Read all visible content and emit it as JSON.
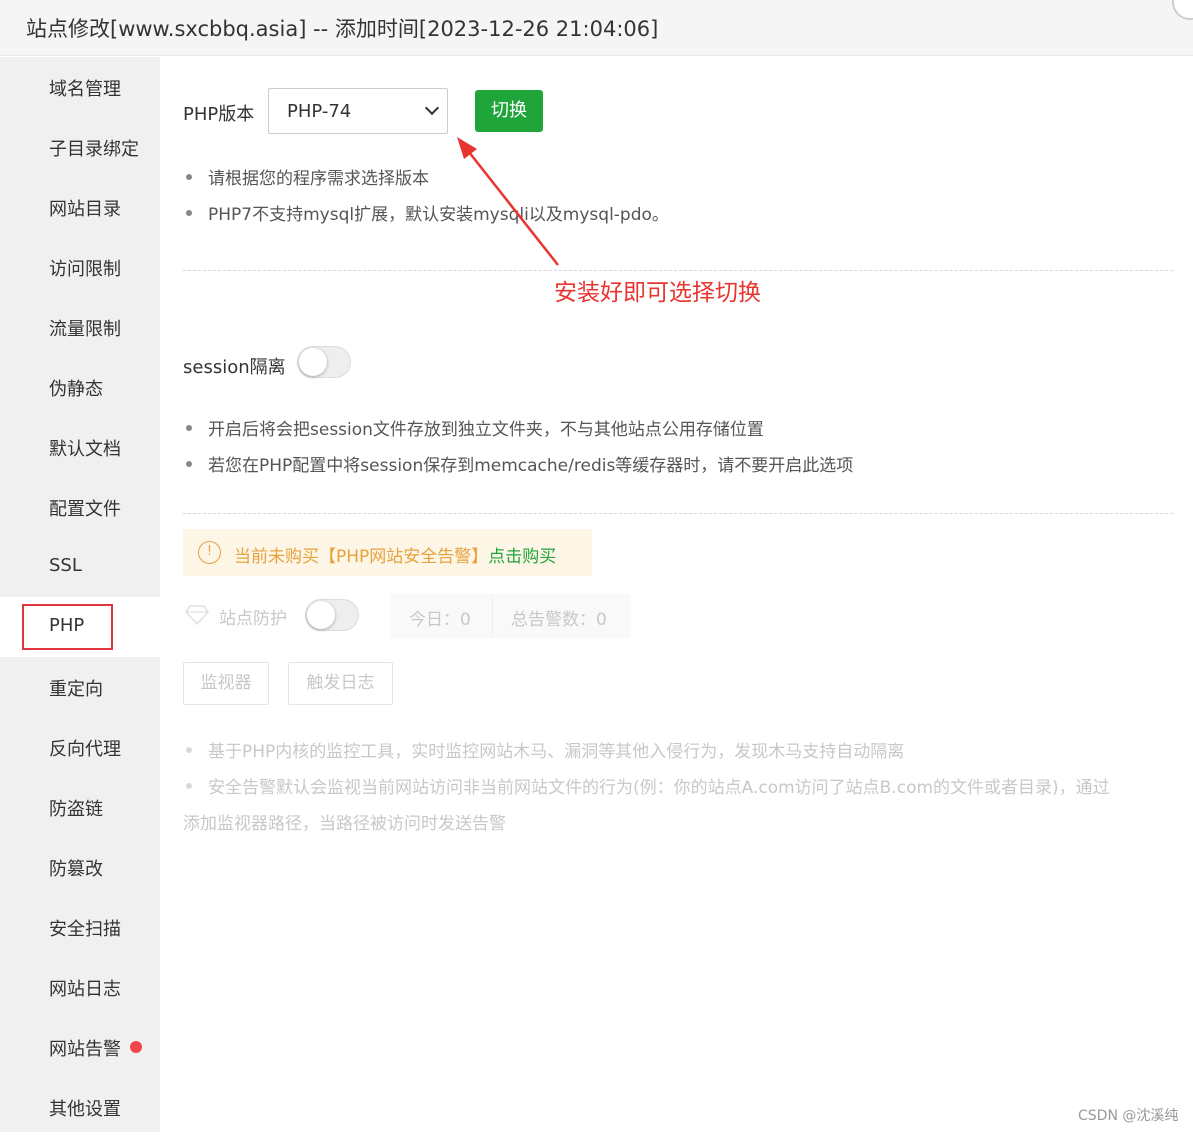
{
  "window": {
    "title": "站点修改[www.sxcbbq.asia] -- 添加时间[2023-12-26 21:04:06]"
  },
  "sidebar": {
    "items": [
      {
        "label": "域名管理"
      },
      {
        "label": "子目录绑定"
      },
      {
        "label": "网站目录"
      },
      {
        "label": "访问限制"
      },
      {
        "label": "流量限制"
      },
      {
        "label": "伪静态"
      },
      {
        "label": "默认文档"
      },
      {
        "label": "配置文件"
      },
      {
        "label": "SSL"
      },
      {
        "label": "PHP",
        "active": true
      },
      {
        "label": "重定向"
      },
      {
        "label": "反向代理"
      },
      {
        "label": "防盗链"
      },
      {
        "label": "防篡改"
      },
      {
        "label": "安全扫描"
      },
      {
        "label": "网站日志"
      },
      {
        "label": "网站告警",
        "badge": "red-dot"
      },
      {
        "label": "其他设置"
      }
    ]
  },
  "php": {
    "label": "PHP版本",
    "selected_version": "PHP-74",
    "switch_label": "切换",
    "tips": [
      "请根据您的程序需求选择版本",
      "PHP7不支持mysql扩展，默认安装mysqli以及mysql-pdo。"
    ]
  },
  "annotation": {
    "text": "安装好即可选择切换",
    "color": "#e8352f"
  },
  "session": {
    "label": "session隔离",
    "enabled": false,
    "tips": [
      "开启后将会把session文件存放到独立文件夹，不与其他站点公用存储位置",
      "若您在PHP配置中将session保存到memcache/redis等缓存器时，请不要开启此选项"
    ]
  },
  "security_alert": {
    "warning_icon": "!",
    "warning_text": "当前未购买【PHP网站安全告警】",
    "buy_link": "点击购买",
    "protection_label": "站点防护",
    "protection_enabled": false,
    "today_label": "今日：0",
    "total_label": "总告警数：0",
    "monitor_button": "监视器",
    "log_button": "触发日志",
    "tip_1": "基于PHP内核的监控工具，实时监控网站木马、漏洞等其他入侵行为，发现木马支持自动隔离",
    "tip_2_line_1": "安全告警默认会监视当前网站访问非当前网站文件的行为(例：你的站点A.com访问了站点B.com的文件或者目录)，通过",
    "tip_2_line_2": "添加监视器路径，当路径被访问时发送告警"
  },
  "watermark": "CSDN @沈溪纯",
  "colors": {
    "accent_green": "#20a53a",
    "warning_orange": "#e6a23c",
    "highlight_red": "#e0353b"
  }
}
